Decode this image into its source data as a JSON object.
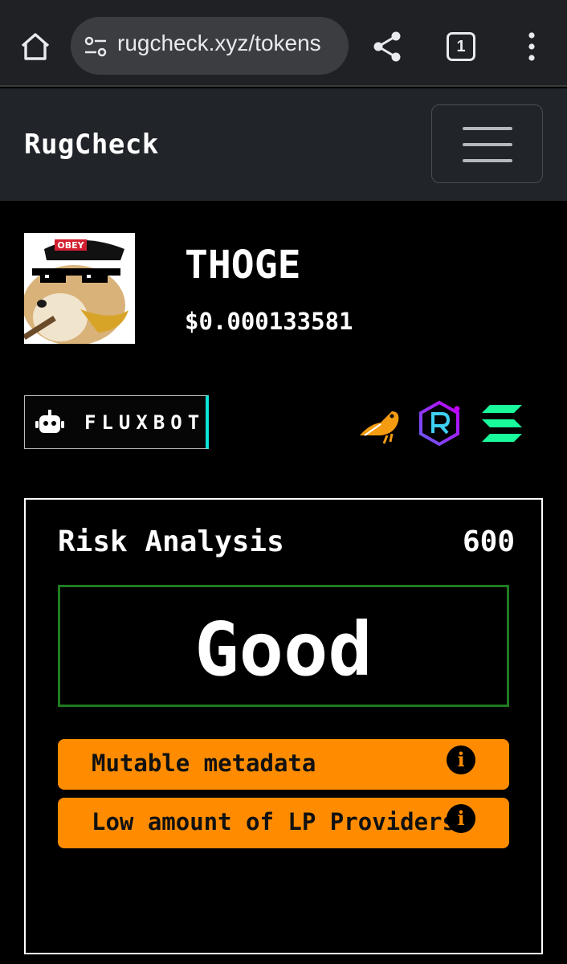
{
  "browser": {
    "url": "rugcheck.xyz/tokens",
    "tab_count": "1",
    "icons": [
      "home-icon",
      "site-settings-icon",
      "share-icon",
      "tab-switcher-icon",
      "overflow-menu-icon"
    ]
  },
  "navbar": {
    "brand": "RugCheck",
    "toggle_icon": "hamburger-menu-icon"
  },
  "token": {
    "name": "THOGE",
    "price": "$0.000133581",
    "logo_text": "OBEY"
  },
  "actions": {
    "fluxbot_label": "FLUXBOT",
    "partners": [
      "birdeye-icon",
      "raydium-icon",
      "solana-icon"
    ]
  },
  "risk": {
    "title": "Risk Analysis",
    "score": "600",
    "verdict": "Good",
    "verdict_border_color": "#1f7a1f",
    "alert_color": "#ff8c00",
    "alerts": [
      {
        "label": "Mutable metadata",
        "icon": "info-icon"
      },
      {
        "label": "Low amount of LP Providers",
        "icon": "info-icon"
      }
    ]
  }
}
